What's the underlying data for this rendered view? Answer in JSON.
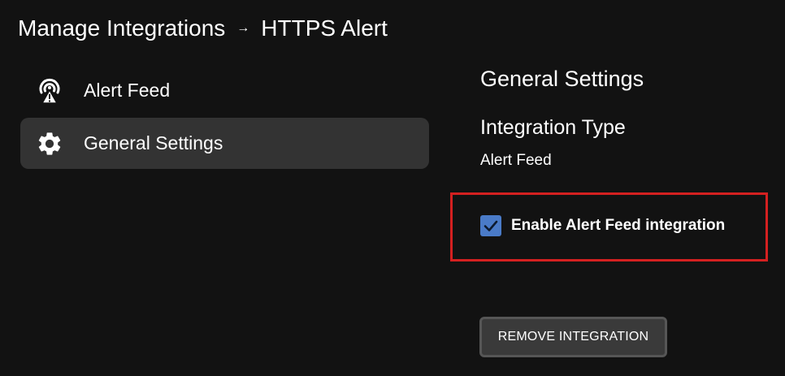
{
  "breadcrumb": {
    "parent": "Manage Integrations",
    "separator": "→",
    "current": "HTTPS Alert"
  },
  "sidebar": {
    "items": [
      {
        "label": "Alert Feed",
        "icon": "alert-feed-icon",
        "active": false
      },
      {
        "label": "General Settings",
        "icon": "gear-icon",
        "active": true
      }
    ]
  },
  "main": {
    "section_title": "General Settings",
    "integration_type_label": "Integration Type",
    "integration_type_value": "Alert Feed",
    "enable_checkbox": {
      "label": "Enable Alert Feed integration",
      "checked": true
    },
    "remove_button_label": "REMOVE INTEGRATION"
  },
  "colors": {
    "background": "#121212",
    "active_item": "#333333",
    "checkbox": "#4a7bc8",
    "highlight_border": "#d42020",
    "button_bg": "#3a3a3a"
  }
}
